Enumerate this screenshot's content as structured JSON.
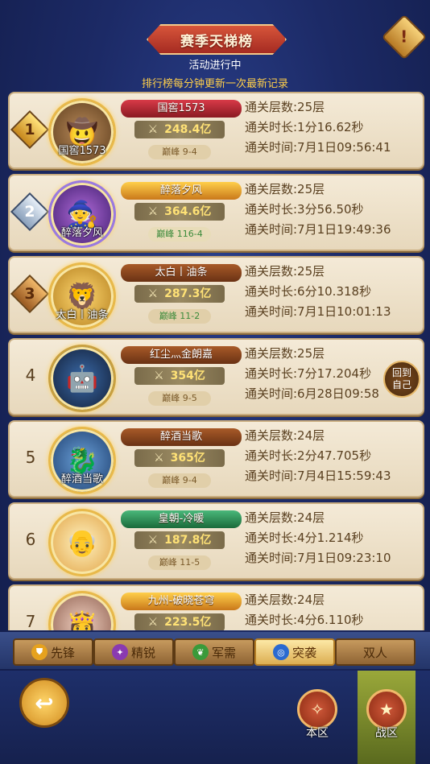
{
  "header": {
    "title": "赛季天梯榜",
    "status": "活动进行中",
    "note": "排行榜每分钟更新一次最新记录"
  },
  "rows": [
    {
      "rank": "1",
      "avatar_name": "国窖1573",
      "name": "国窖1573",
      "power": "248.4亿",
      "peak": "巅峰 9-4",
      "floors": "通关层数:25层",
      "duration": "通关时长:1分16.62秒",
      "time": "通关时间:7月1日09:56:41",
      "plate_color": "#c0303a"
    },
    {
      "rank": "2",
      "avatar_name": "醉落夕风",
      "name": "醉落夕风",
      "power": "364.6亿",
      "peak": "巅峰 116-4",
      "floors": "通关层数:25层",
      "duration": "通关时长:3分56.50秒",
      "time": "通关时间:7月1日19:49:36",
      "plate_color": "#e0a020"
    },
    {
      "rank": "3",
      "avatar_name": "太白丨油条",
      "name": "太白丨油条",
      "power": "287.3亿",
      "peak": "巅峰 11-2",
      "floors": "通关层数:25层",
      "duration": "通关时长:6分10.318秒",
      "time": "通关时间:7月1日10:01:13",
      "plate_color": "#8a4a20"
    },
    {
      "rank": "4",
      "avatar_name": "",
      "name": "红尘灬金朗嘉",
      "power": "354亿",
      "peak": "巅峰 9-5",
      "floors": "通关层数:25层",
      "duration": "通关时长:7分17.204秒",
      "time": "通关时间:6月28日09:58",
      "plate_color": "#8a4a20"
    },
    {
      "rank": "5",
      "avatar_name": "醉酒当歌",
      "name": "醉酒当歌",
      "power": "365亿",
      "peak": "巅峰 9-4",
      "floors": "通关层数:24层",
      "duration": "通关时长:2分47.705秒",
      "time": "通关时间:7月4日15:59:43",
      "plate_color": "#8a4a20"
    },
    {
      "rank": "6",
      "avatar_name": "",
      "name": "皇朝-冷暖",
      "power": "187.8亿",
      "peak": "巅峰 11-5",
      "floors": "通关层数:24层",
      "duration": "通关时长:4分1.214秒",
      "time": "通关时间:7月1日09:23:10",
      "plate_color": "#3a9a6a"
    },
    {
      "rank": "7",
      "avatar_name": "",
      "name": "九州-破晓苍穹",
      "power": "223.5亿",
      "peak": "",
      "floors": "通关层数:24层",
      "duration": "通关时长:4分6.110秒",
      "time": "",
      "plate_color": "#e0a020"
    }
  ],
  "goto_mine": "回到自己",
  "tabs": [
    {
      "label": "先锋",
      "icon": "shield-icon",
      "color": "#e6a21e",
      "active": false
    },
    {
      "label": "精锐",
      "icon": "claw-icon",
      "color": "#8a3ab0",
      "active": false
    },
    {
      "label": "军需",
      "icon": "leaf-icon",
      "color": "#3a9a3a",
      "active": false
    },
    {
      "label": "突袭",
      "icon": "swirl-icon",
      "color": "#2a6ad0",
      "active": true
    },
    {
      "label": "双人",
      "icon": "",
      "color": "",
      "active": false
    }
  ],
  "nav": {
    "local_server": "本区",
    "war_zone": "战区"
  }
}
